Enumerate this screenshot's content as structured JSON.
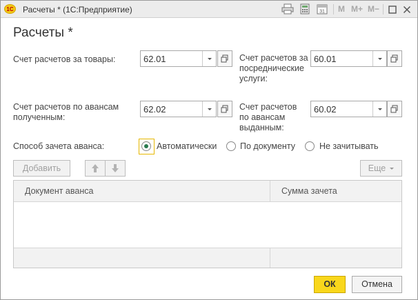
{
  "window": {
    "logo_text": "1С",
    "title": "Расчеты * (1С:Предприятие)",
    "toolbar": {
      "m": "M",
      "m_plus": "M+",
      "m_minus": "M−",
      "calendar_day": "31"
    }
  },
  "form": {
    "heading": "Расчеты *",
    "fields": [
      {
        "label": "Счет расчетов за товары:",
        "value": "62.01"
      },
      {
        "label": "Счет расчетов за посреднические услуги:",
        "value": "60.01"
      },
      {
        "label": "Счет расчетов по авансам полученным:",
        "value": "62.02"
      },
      {
        "label": "Счет расчетов по авансам выданным:",
        "value": "60.02"
      }
    ],
    "advance_method": {
      "label": "Способ зачета аванса:",
      "options": [
        "Автоматически",
        "По документу",
        "Не зачитывать"
      ],
      "selected": "Автоматически"
    },
    "table_toolbar": {
      "add": "Добавить",
      "more": "Еще"
    },
    "table": {
      "columns": [
        "Документ аванса",
        "Сумма зачета"
      ],
      "rows": []
    },
    "footer": {
      "ok": "ОК",
      "cancel": "Отмена"
    }
  },
  "colors": {
    "ok_button": "#f9d71c",
    "focus_frame": "#e6b800",
    "radio_dot": "#2a7a4e"
  }
}
